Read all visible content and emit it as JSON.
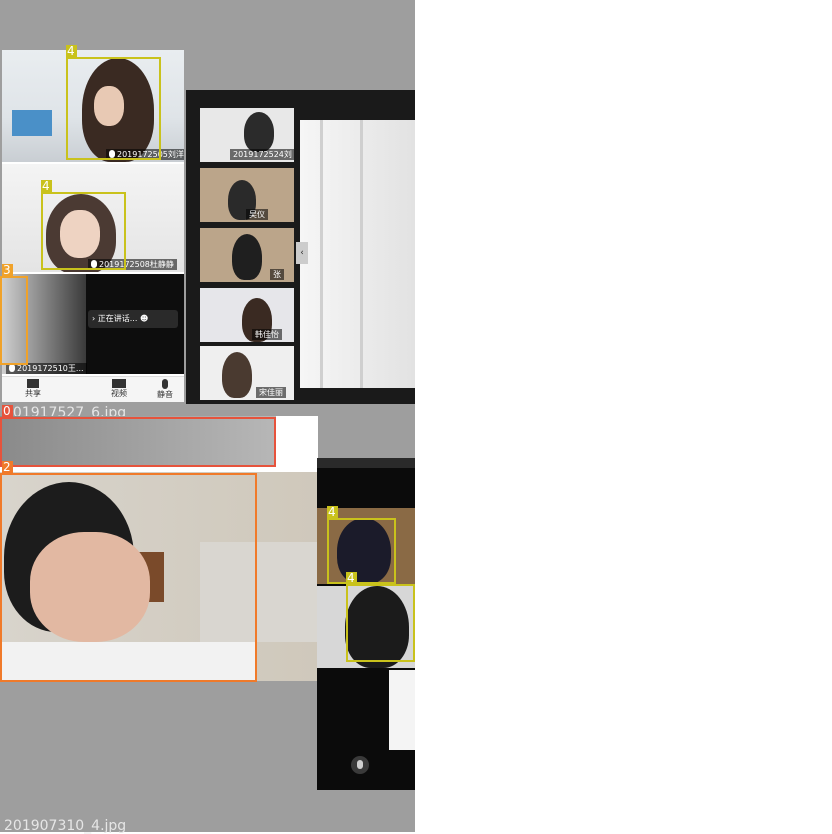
{
  "images": [
    {
      "filename": "201917527_6.jpg",
      "tiles": [
        {
          "label": "2019172505刘洋"
        },
        {
          "label": "2019172508杜静静"
        },
        {
          "label": "2019172510王..."
        }
      ],
      "thumbnails": [
        {
          "label": "2019172524刘"
        },
        {
          "label": "吴仪"
        },
        {
          "label": "张"
        },
        {
          "label": "韩佳怡"
        },
        {
          "label": "宋佳丽"
        }
      ],
      "overlay_text": "正在讲话...",
      "toolbar": [
        {
          "label": "共享"
        },
        {
          "label": "视频"
        },
        {
          "label": "静音"
        }
      ]
    },
    {
      "filename": "201907310_4.jpg"
    }
  ],
  "annotations": [
    {
      "class_id": "4",
      "color": "#c9c21c"
    },
    {
      "class_id": "4",
      "color": "#c9c21c"
    },
    {
      "class_id": "3",
      "color": "#f0a22a"
    },
    {
      "class_id": "0",
      "color": "#e6533c"
    },
    {
      "class_id": "2",
      "color": "#f07a2a"
    },
    {
      "class_id": "4",
      "color": "#c9c21c"
    },
    {
      "class_id": "4",
      "color": "#c9c21c"
    }
  ]
}
